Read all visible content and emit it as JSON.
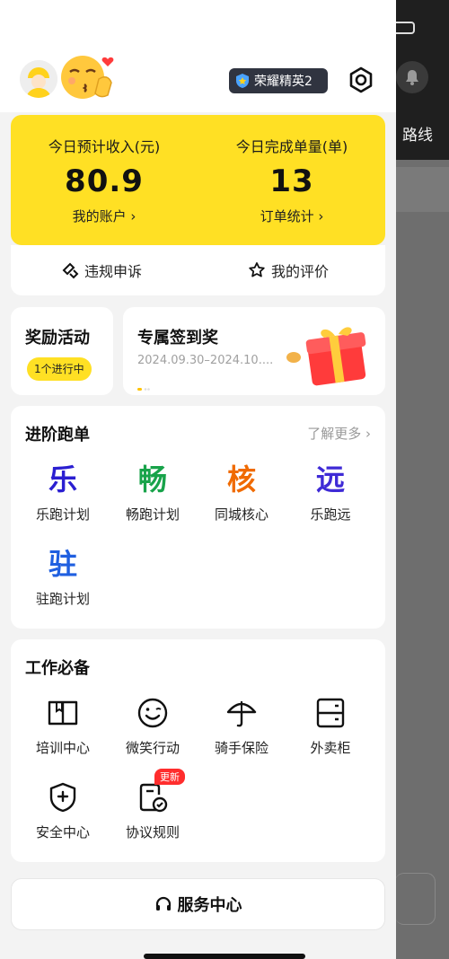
{
  "background_app": {
    "route_label": "路线"
  },
  "header": {
    "rank_badge": "荣耀精英2"
  },
  "income": {
    "income_label": "今日预计收入(元)",
    "income_value": "80.9",
    "account_link": "我的账户 ›",
    "orders_label": "今日完成单量(单)",
    "orders_value": "13",
    "orders_link": "订单统计 ›"
  },
  "actions": {
    "appeal": "违规申诉",
    "reviews": "我的评价"
  },
  "reward": {
    "title": "奖励活动",
    "pill": "1个进行中"
  },
  "signin": {
    "title": "专属签到奖",
    "date": "2024.09.30–2024.10...."
  },
  "advance": {
    "title": "进阶跑单",
    "more": "了解更多 ›",
    "items": [
      {
        "glyph": "乐",
        "label": "乐跑计划",
        "color": "#2b1fd1"
      },
      {
        "glyph": "畅",
        "label": "畅跑计划",
        "color": "#18a34a"
      },
      {
        "glyph": "核",
        "label": "同城核心",
        "color": "#f06a00"
      },
      {
        "glyph": "远",
        "label": "乐跑远",
        "color": "#3e2ad6"
      },
      {
        "glyph": "驻",
        "label": "驻跑计划",
        "color": "#1f5fe0"
      }
    ]
  },
  "work": {
    "title": "工作必备",
    "items": [
      {
        "label": "培训中心",
        "icon": "book-icon"
      },
      {
        "label": "微笑行动",
        "icon": "smile-icon"
      },
      {
        "label": "骑手保险",
        "icon": "umbrella-icon"
      },
      {
        "label": "外卖柜",
        "icon": "locker-icon"
      },
      {
        "label": "安全中心",
        "icon": "shield-icon"
      },
      {
        "label": "协议规则",
        "icon": "agreement-icon",
        "badge": "更新"
      }
    ]
  },
  "service": {
    "label": "服务中心"
  }
}
